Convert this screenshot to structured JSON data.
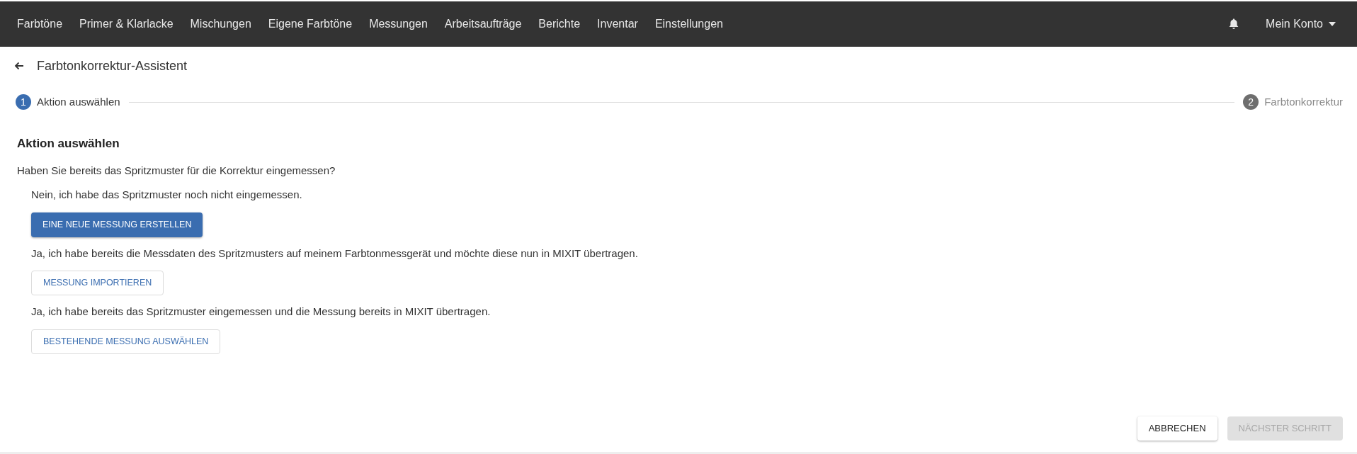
{
  "nav": {
    "items": [
      {
        "label": "Farbtöne"
      },
      {
        "label": "Primer & Klarlacke"
      },
      {
        "label": "Mischungen"
      },
      {
        "label": "Eigene Farbtöne"
      },
      {
        "label": "Messungen"
      },
      {
        "label": "Arbeitsaufträge"
      },
      {
        "label": "Berichte"
      },
      {
        "label": "Inventar"
      },
      {
        "label": "Einstellungen"
      }
    ],
    "account": "Mein Konto"
  },
  "page_title": "Farbtonkorrektur-Assistent",
  "steps": [
    {
      "number": "1",
      "label": "Aktion auswählen",
      "selected": true
    },
    {
      "number": "2",
      "label": "Farbtonkorrektur",
      "selected": false
    }
  ],
  "section_title": "Aktion auswählen",
  "question": "Haben Sie bereits das Spritzmuster für die Korrektur eingemessen?",
  "options": [
    {
      "text": "Nein, ich habe das Spritzmuster noch nicht eingemessen.",
      "button": "EINE NEUE MESSUNG ERSTELLEN",
      "kind": "primary"
    },
    {
      "text": "Ja, ich habe bereits die Messdaten des Spritzmusters auf meinem Farbtonmessgerät und möchte diese nun in MIXIT übertragen.",
      "button": "MESSUNG IMPORTIEREN",
      "kind": "outline"
    },
    {
      "text": "Ja, ich habe bereits das Spritzmuster eingemessen und die Messung bereits in MIXIT übertragen.",
      "button": "BESTEHENDE MESSUNG AUSWÄHLEN",
      "kind": "outline"
    }
  ],
  "footer": {
    "cancel": {
      "label": "ABBRECHEN",
      "disabled": false
    },
    "next": {
      "label": "NÄCHSTER SCHRITT",
      "disabled": true
    }
  }
}
